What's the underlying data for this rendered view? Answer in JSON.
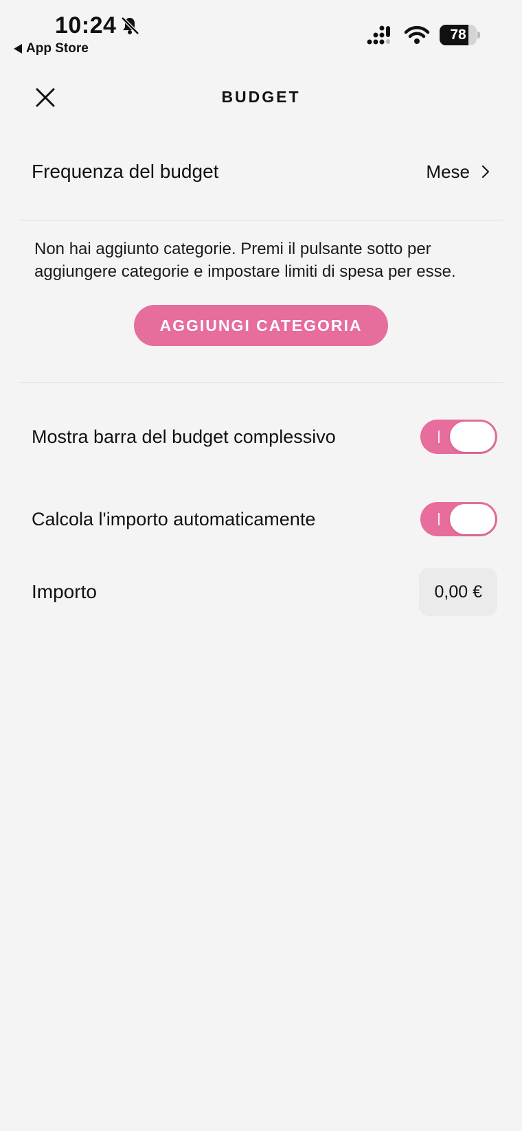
{
  "status_bar": {
    "time": "10:24",
    "back_app": "App Store",
    "battery_level": "78",
    "battery_fraction": 0.78
  },
  "header": {
    "title": "BUDGET"
  },
  "frequency": {
    "label": "Frequenza del budget",
    "value": "Mese"
  },
  "categories": {
    "empty_text": "Non hai aggiunto categorie. Premi il pulsante sotto per aggiungere categorie e impostare limiti di spesa per esse.",
    "add_button": "AGGIUNGI CATEGORIA"
  },
  "toggles": [
    {
      "label": "Mostra barra del budget complessivo",
      "on": true
    },
    {
      "label": "Calcola l'importo automaticamente",
      "on": true
    }
  ],
  "amount": {
    "label": "Importo",
    "value": "0,00 €"
  },
  "colors": {
    "accent": "#e66d9c",
    "background": "#f4f4f4"
  }
}
